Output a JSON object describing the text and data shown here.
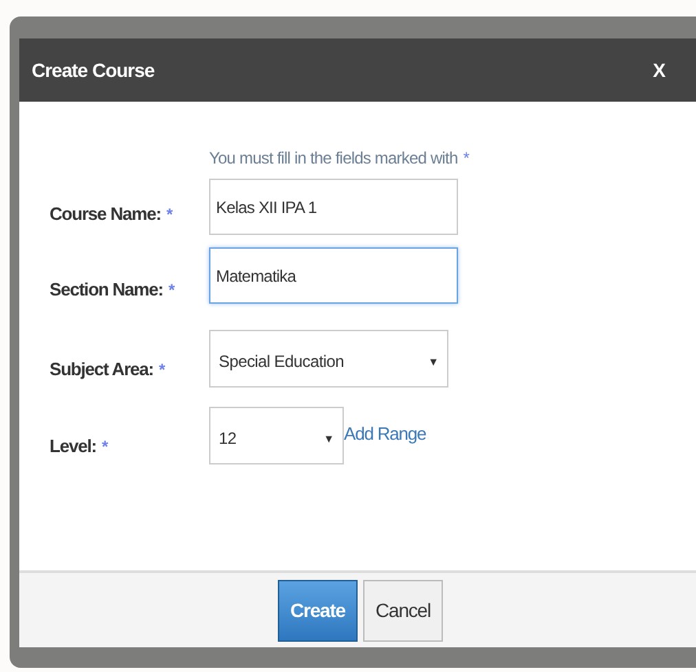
{
  "dialog": {
    "title": "Create Course",
    "close": "X"
  },
  "hint": {
    "text": "You must fill in the fields marked with",
    "mark": "*"
  },
  "fields": [
    {
      "kind": "text",
      "label": "Course Name:",
      "required": true,
      "value": "Kelas XII IPA 1",
      "focused": false
    },
    {
      "kind": "text",
      "label": "Section Name:",
      "required": true,
      "value": "Matematika",
      "focused": true
    },
    {
      "kind": "select",
      "label": "Subject Area:",
      "required": true,
      "value": "Special Education",
      "arrow": "▼"
    },
    {
      "kind": "select",
      "label": "Level:",
      "required": true,
      "value": "12",
      "arrow": "▼",
      "link": "Add Range"
    }
  ],
  "buttons": [
    {
      "label": "Create",
      "kind": "primary"
    },
    {
      "label": "Cancel",
      "kind": "secondary"
    }
  ]
}
